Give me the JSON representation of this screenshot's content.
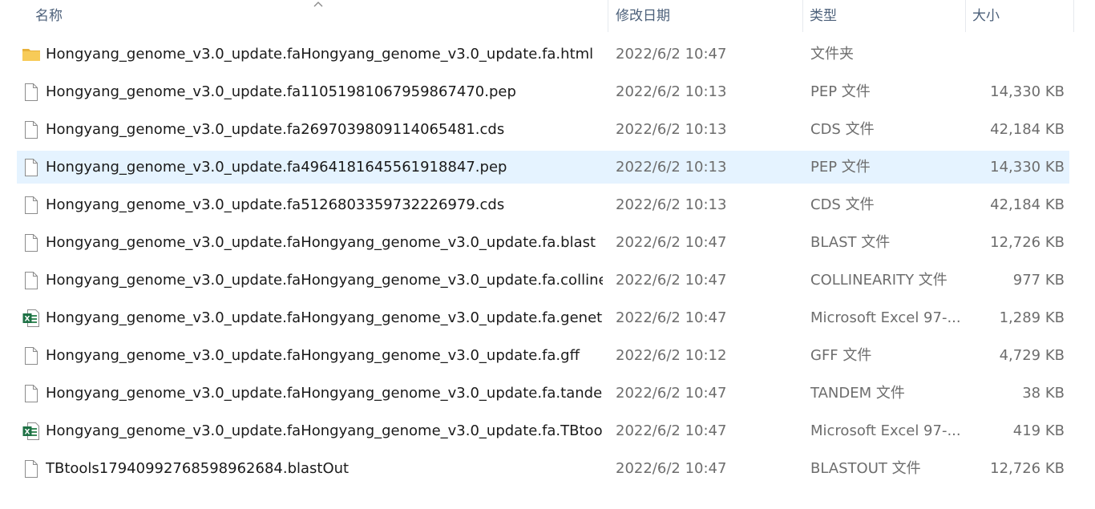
{
  "columns": {
    "name": "名称",
    "date": "修改日期",
    "type": "类型",
    "size": "大小"
  },
  "sort": {
    "column": "name",
    "direction": "ascending",
    "icon": "sort-up-icon"
  },
  "colors": {
    "selected_row": "#e5f3ff",
    "folder": "#f5c64f",
    "excel": "#1e7145"
  },
  "files": [
    {
      "name": "Hongyang_genome_v3.0_update.faHongyang_genome_v3.0_update.fa.html",
      "date": "2022/6/2 10:47",
      "type": "文件夹",
      "size": "",
      "icon": "folder-icon"
    },
    {
      "name": "Hongyang_genome_v3.0_update.fa1105198106795986 7470.pep",
      "date": "2022/6/2 10:13",
      "type": "PEP 文件",
      "size": "14,330 KB",
      "icon": "file-icon"
    },
    {
      "name": "Hongyang_genome_v3.0_update.fa2697039809114065481.cds",
      "date": "2022/6/2 10:13",
      "type": "CDS 文件",
      "size": "42,184 KB",
      "icon": "file-icon"
    },
    {
      "name": "Hongyang_genome_v3.0_update.fa4964181645561918847.pep",
      "date": "2022/6/2 10:13",
      "type": "PEP 文件",
      "size": "14,330 KB",
      "icon": "file-icon",
      "selected": true
    },
    {
      "name": "Hongyang_genome_v3.0_update.fa5126803359732226979.cds",
      "date": "2022/6/2 10:13",
      "type": "CDS 文件",
      "size": "42,184 KB",
      "icon": "file-icon"
    },
    {
      "name": "Hongyang_genome_v3.0_update.faHongyang_genome_v3.0_update.fa.blast",
      "date": "2022/6/2 10:47",
      "type": "BLAST 文件",
      "size": "12,726 KB",
      "icon": "file-icon"
    },
    {
      "name": "Hongyang_genome_v3.0_update.faHongyang_genome_v3.0_update.fa.collinea...",
      "date": "2022/6/2 10:47",
      "type": "COLLINEARITY 文件",
      "size": "977 KB",
      "icon": "file-icon"
    },
    {
      "name": "Hongyang_genome_v3.0_update.faHongyang_genome_v3.0_update.fa.genety...",
      "date": "2022/6/2 10:47",
      "type": "Microsoft Excel 97-...",
      "size": "1,289 KB",
      "icon": "excel-icon"
    },
    {
      "name": "Hongyang_genome_v3.0_update.faHongyang_genome_v3.0_update.fa.gff",
      "date": "2022/6/2 10:12",
      "type": "GFF 文件",
      "size": "4,729 KB",
      "icon": "file-icon"
    },
    {
      "name": "Hongyang_genome_v3.0_update.faHongyang_genome_v3.0_update.fa.tandem",
      "date": "2022/6/2 10:47",
      "type": "TANDEM 文件",
      "size": "38 KB",
      "icon": "file-icon"
    },
    {
      "name": "Hongyang_genome_v3.0_update.faHongyang_genome_v3.0_update.fa.TBtools....",
      "date": "2022/6/2 10:47",
      "type": "Microsoft Excel 97-...",
      "size": "419 KB",
      "icon": "excel-icon"
    },
    {
      "name": "TBtools1794099276859896 2684.blastOut",
      "date": "2022/6/2 10:47",
      "type": "BLASTOUT 文件",
      "size": "12,726 KB",
      "icon": "file-icon"
    }
  ]
}
